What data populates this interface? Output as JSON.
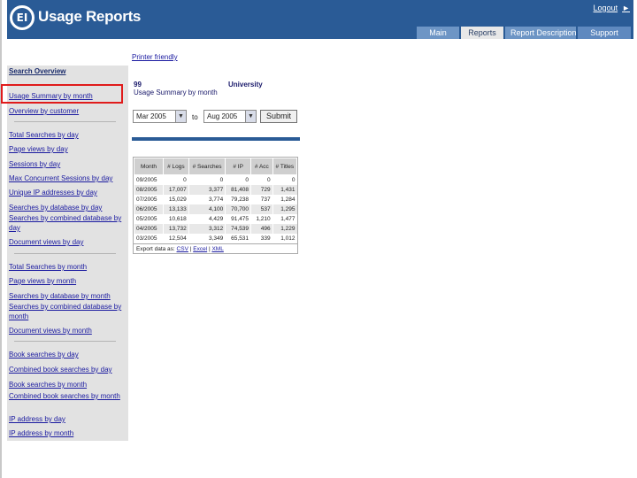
{
  "header": {
    "logo_text": "EI",
    "title": "Usage Reports",
    "logout_label": "Logout",
    "tabs": [
      {
        "label": "Main"
      },
      {
        "label": "Reports"
      },
      {
        "label": "Report Description"
      },
      {
        "label": "Support"
      }
    ]
  },
  "sidebar": {
    "heading": "Search Overview",
    "group1": [
      "Usage Summary by month",
      "Overview by customer"
    ],
    "group2": [
      "Total Searches by day",
      "Page views by day",
      "Sessions by day",
      "Max Concurrent Sessions by day",
      "Unique IP addresses by day",
      "Searches by database by day",
      "Searches by combined database by day",
      "Document views by day"
    ],
    "group3": [
      "Total Searches by month",
      "Page views by month",
      "Searches by database by month",
      "Searches by combined database by month",
      "Document views by month"
    ],
    "group4": [
      "Book searches by day",
      "Combined book searches by day",
      "Book searches by month",
      "Combined book searches by month",
      "IP address by day",
      "IP address by month"
    ]
  },
  "main": {
    "print_link": "Printer friendly",
    "institution_number": "99",
    "institution_name": "University",
    "report_name": "Usage Summary by month",
    "from_value": "Mar 2005",
    "to_label": "to",
    "to_value": "Aug 2005",
    "submit_label": "Submit"
  },
  "table": {
    "headers": [
      "Month",
      "# Logs",
      "# Searches",
      "# IP",
      "# Acc",
      "# Titles"
    ],
    "rows": [
      [
        "09/2005",
        "0",
        "0",
        "0",
        "0",
        "0"
      ],
      [
        "08/2005",
        "17,007",
        "3,377",
        "81,408",
        "729",
        "1,431"
      ],
      [
        "07/2005",
        "15,029",
        "3,774",
        "79,238",
        "737",
        "1,284"
      ],
      [
        "06/2005",
        "13,133",
        "4,100",
        "70,700",
        "537",
        "1,295"
      ],
      [
        "05/2005",
        "10,618",
        "4,429",
        "91,475",
        "1,210",
        "1,477"
      ],
      [
        "04/2005",
        "13,732",
        "3,312",
        "74,539",
        "496",
        "1,229"
      ],
      [
        "03/2005",
        "12,504",
        "3,349",
        "65,531",
        "339",
        "1,012"
      ]
    ],
    "export_prefix": "Export data as:",
    "export_options": [
      "CSV",
      "Excel",
      "XML"
    ]
  }
}
